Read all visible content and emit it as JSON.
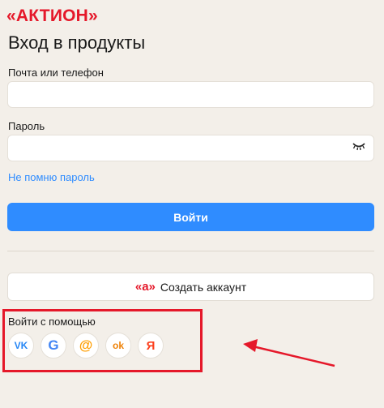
{
  "brand": {
    "logo_text": "«АКТИОН»",
    "logo_color": "#e5182a"
  },
  "page": {
    "title": "Вход в продукты"
  },
  "login": {
    "label": "Почта или телефон",
    "value": "",
    "placeholder": ""
  },
  "password": {
    "label": "Пароль",
    "value": "",
    "placeholder": "",
    "toggle_icon": "eye-closed-icon"
  },
  "links": {
    "forgot": "Не помню пароль"
  },
  "buttons": {
    "login": "Войти",
    "create": "Создать аккаунт",
    "create_icon_text": "«а»"
  },
  "social": {
    "label": "Войти с помощью",
    "providers": [
      {
        "name": "vk",
        "glyph": "VK",
        "color": "#2787f5"
      },
      {
        "name": "google",
        "glyph": "G",
        "color": "#4285f4"
      },
      {
        "name": "mail",
        "glyph": "@",
        "color": "#ff9e00"
      },
      {
        "name": "odnoklassniki",
        "glyph": "ok",
        "color": "#ee8208"
      },
      {
        "name": "yandex",
        "glyph": "Я",
        "color": "#fc3f1d"
      }
    ]
  },
  "colors": {
    "accent": "#2f8cff",
    "brand_red": "#e5182a",
    "annotation_red": "#e5182a"
  }
}
